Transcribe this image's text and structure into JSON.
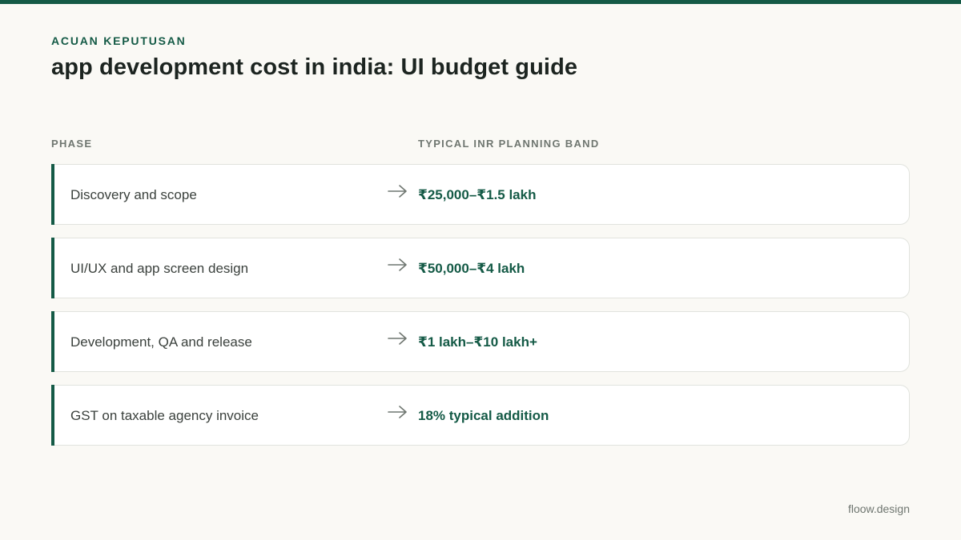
{
  "header": {
    "eyebrow": "ACUAN KEPUTUSAN",
    "title": "app development cost in india: UI budget guide"
  },
  "table": {
    "columns": [
      "PHASE",
      "TYPICAL INR PLANNING BAND"
    ],
    "rows": [
      {
        "phase": "Discovery and scope",
        "band": "₹25,000–₹1.5 lakh"
      },
      {
        "phase": "UI/UX and app screen design",
        "band": "₹50,000–₹4 lakh"
      },
      {
        "phase": "Development, QA and release",
        "band": "₹1 lakh–₹10 lakh+"
      },
      {
        "phase": "GST on taxable agency invoice",
        "band": "18% typical addition"
      }
    ]
  },
  "footer": {
    "brand": "floow.design"
  },
  "icons": {
    "row_arrow": "arrow-right-icon"
  },
  "colors": {
    "accent": "#145a46",
    "background": "#faf9f5"
  }
}
